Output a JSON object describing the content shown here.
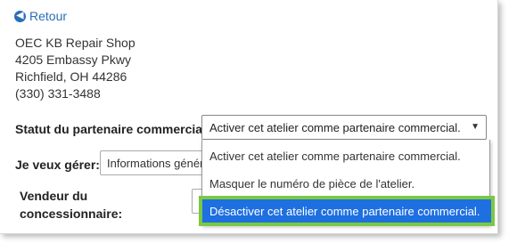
{
  "back": {
    "label": "Retour",
    "icon": "arrow-left-circle-icon"
  },
  "address": {
    "name": "OEC KB Repair Shop",
    "street": "4205 Embassy Pkwy",
    "city": "Richfield, OH 44286",
    "phone": "(330) 331-3488"
  },
  "form": {
    "status_label": "Statut du partenaire commercial",
    "status_value": "Activer cet atelier comme partenaire commercial.",
    "manage_label": "Je veux gérer:",
    "manage_value": "Informations généra",
    "dealer_label_line1": "Vendeur du",
    "dealer_label_line2": "concessionnaire:"
  },
  "dropdown": {
    "options": [
      "Activer cet atelier comme partenaire commercial.",
      "Masquer le numéro de pièce de l'atelier.",
      "Désactiver cet atelier comme partenaire commercial."
    ],
    "highlighted_index": 2
  },
  "colors": {
    "link": "#2a6fb5",
    "highlight": "#1e6fe0",
    "highlight_outline": "#7ac943"
  }
}
